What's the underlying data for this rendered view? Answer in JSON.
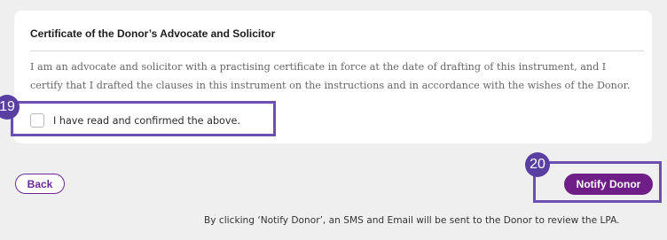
{
  "certificate": {
    "title": "Certificate of the Donor’s Advocate and Solicitor",
    "text_line_1": "I am an advocate and solicitor with a practising certificate in force at the date of drafting of this instrument, and I",
    "text_line_2": "certify that I drafted the clauses in this instrument on the instructions and in accordance with the wishes of the Donor.",
    "confirm_label": "I have read and confirmed the above.",
    "confirmed": false
  },
  "actions": {
    "back_label": "Back",
    "notify_label": "Notify Donor",
    "footer_note": "By clicking ‘Notify Donor’, an SMS and Email will be sent to the Donor to review the LPA."
  },
  "annotations": {
    "step_19": "19",
    "step_20": "20"
  },
  "colors": {
    "page_background": "#efeff0",
    "card_background": "#ffffff",
    "brand_purple": "#6e1e86",
    "annotation_purple": "#5a3fa3"
  }
}
